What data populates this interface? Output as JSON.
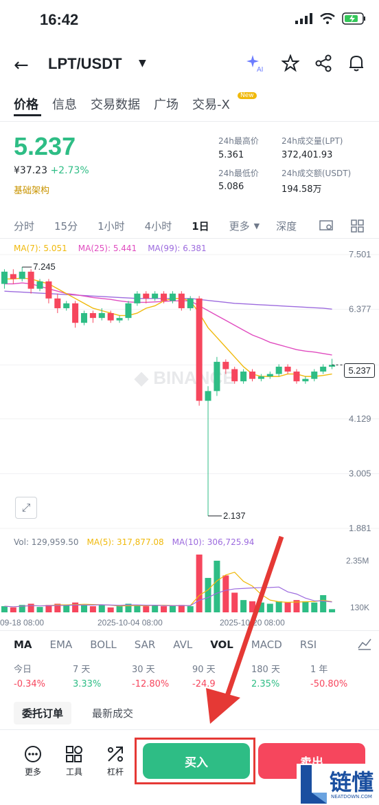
{
  "status": {
    "time": "16:42"
  },
  "header": {
    "pair": "LPT/USDT"
  },
  "tabs": [
    "价格",
    "信息",
    "交易数据",
    "广场",
    "交易-X"
  ],
  "new_badge": "New",
  "ticker": {
    "price": "5.237",
    "cny": "¥37.23",
    "change": "+2.73%",
    "tag": "基础架构",
    "high_label": "24h最高价",
    "high": "5.361",
    "low_label": "24h最低价",
    "low": "5.086",
    "vol_lpt_label": "24h成交量(LPT)",
    "vol_lpt": "372,401.93",
    "vol_usdt_label": "24h成交额(USDT)",
    "vol_usdt": "194.58万"
  },
  "timeframes": [
    "分时",
    "15分",
    "1小时",
    "4小时",
    "1日",
    "更多",
    "深度"
  ],
  "ma": {
    "ma7": "MA(7): 5.051",
    "ma25": "MA(25): 5.441",
    "ma99": "MA(99): 6.381"
  },
  "price_axis": [
    "7.501",
    "6.377",
    "5.237",
    "4.129",
    "3.005",
    "1.881"
  ],
  "annotations": {
    "high": "7.245",
    "low": "2.137"
  },
  "watermark": "BINANCE",
  "volume": {
    "vol": "Vol: 129,959.50",
    "ma5": "MA(5): 317,877.08",
    "ma10": "MA(10): 306,725.94",
    "axis_top": "2.35M",
    "axis_bottom": "130K"
  },
  "dates": [
    "09-18 08:00",
    "2025-10-04 08:00",
    "2025-10-20 08:00"
  ],
  "indicators": [
    "MA",
    "EMA",
    "BOLL",
    "SAR",
    "AVL",
    "VOL",
    "MACD",
    "RSI"
  ],
  "performance": [
    {
      "label": "今日",
      "value": "-0.34%"
    },
    {
      "label": "7 天",
      "value": "3.33%"
    },
    {
      "label": "30 天",
      "value": "-12.80%"
    },
    {
      "label": "90 天",
      "value": "-24.9"
    },
    {
      "label": "180 天",
      "value": "2.35%"
    },
    {
      "label": "1 年",
      "value": "-50.80%"
    }
  ],
  "order_tabs": {
    "orders": "委托订单",
    "trades": "最新成交"
  },
  "toolbar": {
    "more": "更多",
    "tools": "工具",
    "leverage": "杠杆",
    "buy": "买入",
    "sell": "卖出"
  },
  "brand": {
    "name": "链懂",
    "url": "NEATDOWN.COM"
  },
  "colors": {
    "up": "#2ebd85",
    "down": "#f6465d",
    "ma7": "#f0b90b",
    "ma25": "#e04bbf",
    "ma99": "#9c6ade",
    "accent": "#f0b90b"
  },
  "chart_data": {
    "type": "candlestick",
    "candles": [
      [
        6.9,
        7.15,
        6.8,
        7.2
      ],
      [
        7.1,
        7.0,
        6.9,
        7.2
      ],
      [
        7.0,
        7.15,
        6.95,
        7.245
      ],
      [
        7.15,
        6.8,
        6.7,
        7.2
      ],
      [
        6.8,
        6.95,
        6.75,
        7.0
      ],
      [
        6.95,
        6.6,
        6.5,
        7.0
      ],
      [
        6.6,
        6.4,
        6.3,
        6.7
      ],
      [
        6.4,
        6.5,
        6.35,
        6.55
      ],
      [
        6.5,
        6.1,
        6.0,
        6.55
      ],
      [
        6.1,
        6.3,
        6.05,
        6.35
      ],
      [
        6.3,
        6.2,
        6.1,
        6.35
      ],
      [
        6.2,
        6.3,
        6.15,
        6.4
      ],
      [
        6.3,
        6.15,
        6.1,
        6.35
      ],
      [
        6.15,
        6.2,
        6.1,
        6.25
      ],
      [
        6.2,
        6.5,
        6.15,
        6.55
      ],
      [
        6.5,
        6.7,
        6.45,
        6.75
      ],
      [
        6.7,
        6.6,
        6.5,
        6.75
      ],
      [
        6.6,
        6.7,
        6.55,
        6.75
      ],
      [
        6.7,
        6.55,
        6.5,
        6.75
      ],
      [
        6.55,
        6.7,
        6.5,
        6.75
      ],
      [
        6.7,
        6.4,
        6.35,
        6.75
      ],
      [
        6.4,
        6.6,
        6.35,
        6.65
      ],
      [
        6.6,
        4.5,
        4.4,
        6.65
      ],
      [
        4.5,
        4.7,
        2.137,
        4.8
      ],
      [
        4.7,
        5.3,
        4.6,
        5.4
      ],
      [
        5.3,
        5.15,
        5.05,
        5.35
      ],
      [
        5.15,
        4.9,
        4.85,
        5.2
      ],
      [
        4.9,
        5.1,
        4.85,
        5.15
      ],
      [
        5.1,
        4.95,
        4.9,
        5.15
      ],
      [
        4.95,
        5.0,
        4.9,
        5.05
      ],
      [
        5.0,
        5.05,
        4.95,
        5.1
      ],
      [
        5.05,
        5.2,
        5.0,
        5.25
      ],
      [
        5.2,
        5.1,
        5.05,
        5.25
      ],
      [
        5.1,
        4.9,
        4.85,
        5.15
      ],
      [
        4.9,
        4.95,
        4.85,
        5.0
      ],
      [
        4.95,
        5.1,
        4.9,
        5.15
      ],
      [
        5.1,
        5.2,
        5.05,
        5.25
      ],
      [
        5.2,
        5.237,
        5.15,
        5.361
      ]
    ],
    "ma7": [
      7.0,
      7.0,
      7.02,
      7.0,
      6.95,
      6.9,
      6.8,
      6.7,
      6.6,
      6.5,
      6.4,
      6.35,
      6.3,
      6.25,
      6.25,
      6.3,
      6.4,
      6.45,
      6.55,
      6.6,
      6.6,
      6.55,
      6.3,
      6.0,
      5.8,
      5.6,
      5.4,
      5.2,
      5.05,
      5.0,
      5.0,
      5.0,
      5.05,
      5.05,
      5.0,
      5.0,
      5.02,
      5.051
    ],
    "ma25": [
      6.9,
      6.9,
      6.92,
      6.9,
      6.85,
      6.8,
      6.75,
      6.7,
      6.68,
      6.65,
      6.62,
      6.6,
      6.58,
      6.55,
      6.53,
      6.52,
      6.52,
      6.53,
      6.54,
      6.55,
      6.55,
      6.55,
      6.45,
      6.35,
      6.25,
      6.15,
      6.05,
      5.95,
      5.85,
      5.78,
      5.7,
      5.65,
      5.6,
      5.55,
      5.52,
      5.5,
      5.47,
      5.441
    ],
    "ma99": [
      6.75,
      6.74,
      6.73,
      6.72,
      6.71,
      6.7,
      6.69,
      6.68,
      6.67,
      6.66,
      6.65,
      6.64,
      6.63,
      6.62,
      6.61,
      6.6,
      6.6,
      6.6,
      6.6,
      6.6,
      6.6,
      6.6,
      6.58,
      6.56,
      6.54,
      6.52,
      6.5,
      6.49,
      6.48,
      6.47,
      6.46,
      6.45,
      6.44,
      6.43,
      6.42,
      6.41,
      6.4,
      6.381
    ],
    "volumes": [
      0.25,
      0.2,
      0.3,
      0.35,
      0.22,
      0.3,
      0.35,
      0.3,
      0.4,
      0.3,
      0.25,
      0.3,
      0.2,
      0.25,
      0.35,
      0.3,
      0.25,
      0.3,
      0.25,
      0.28,
      0.3,
      0.25,
      2.35,
      1.4,
      2.1,
      1.5,
      0.8,
      0.5,
      0.45,
      0.4,
      0.35,
      0.45,
      0.4,
      0.5,
      0.45,
      0.4,
      0.7,
      0.13
    ],
    "ylim": [
      1.881,
      7.501
    ],
    "vol_ylim": [
      0.13,
      2.35
    ]
  }
}
